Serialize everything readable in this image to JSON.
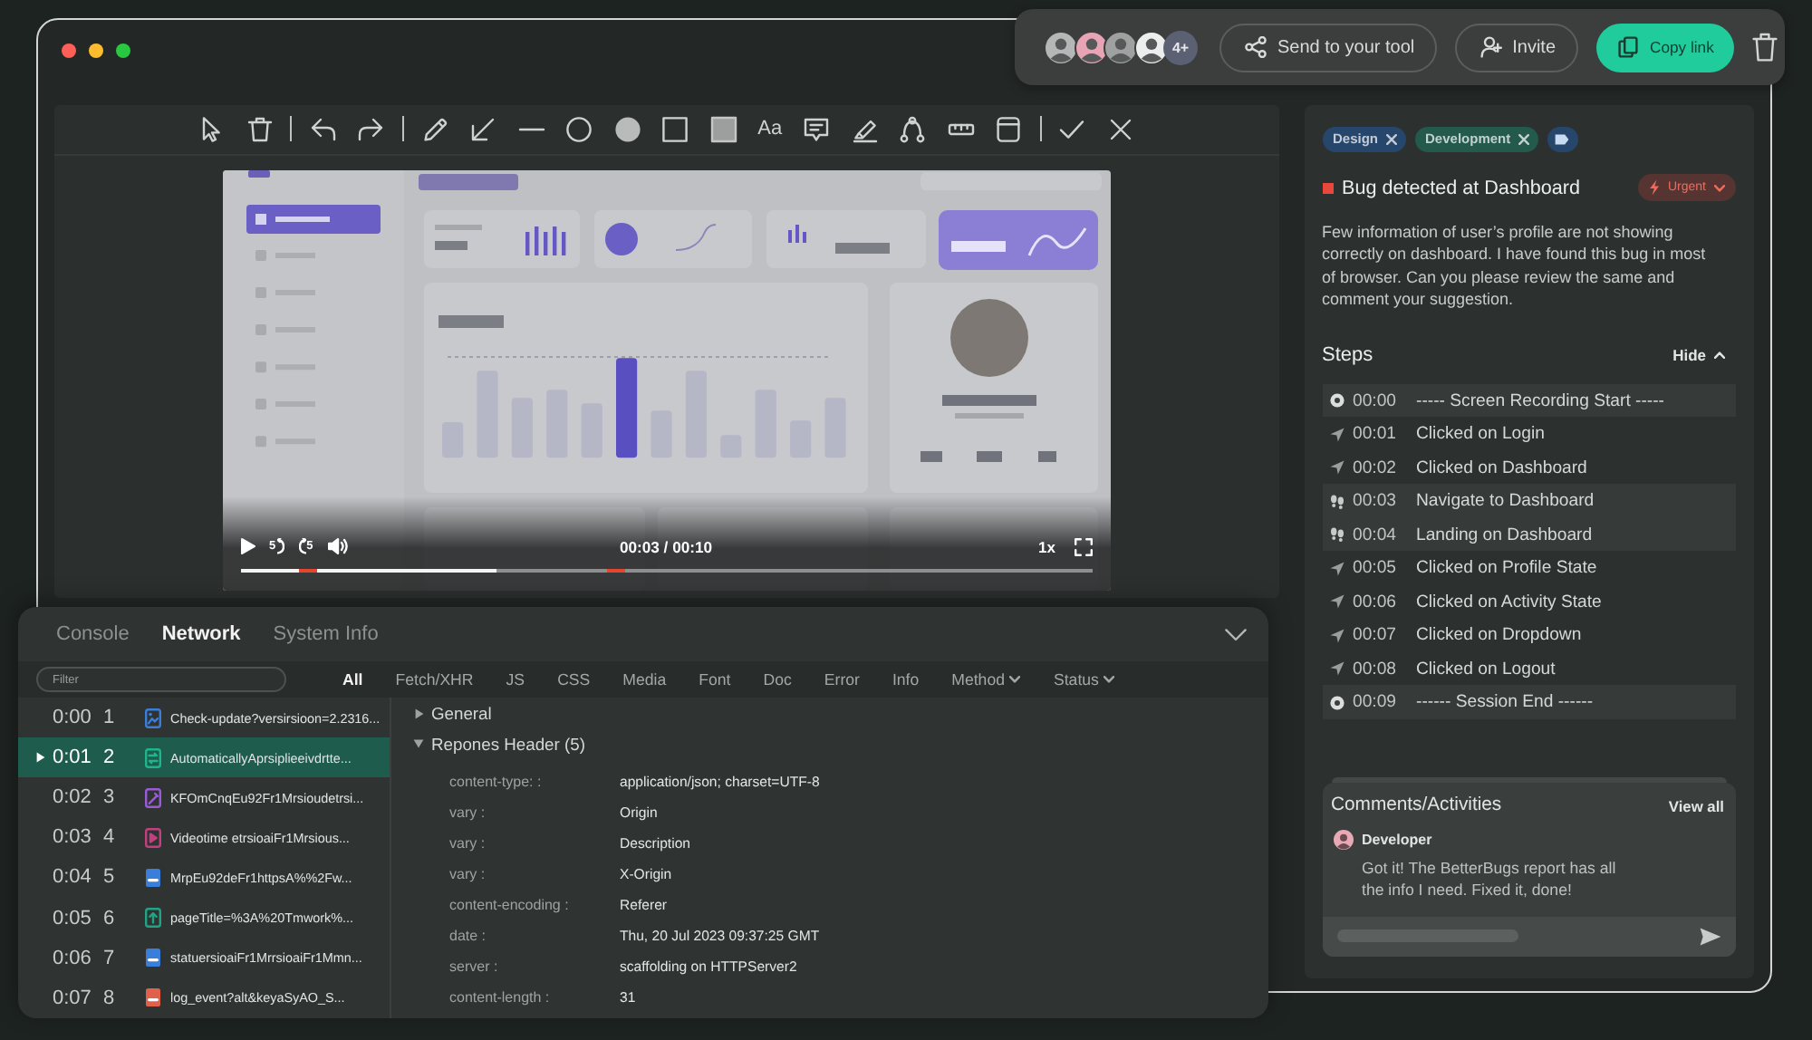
{
  "share_bar": {
    "avatars": [
      {
        "color": "#b4b7b6"
      },
      {
        "color": "#e6a4b4"
      },
      {
        "color": "#9ea1a0"
      },
      {
        "color": "#eceeed"
      }
    ],
    "more_count": "4+",
    "buttons": [
      {
        "kind": "share",
        "label": "Send to your tool"
      },
      {
        "kind": "invite",
        "label": "Invite"
      },
      {
        "kind": "copy",
        "label": "Copy link"
      }
    ]
  },
  "annotation_toolbar": {
    "tools": [
      {
        "kind": "pointer"
      },
      {
        "kind": "trash"
      },
      {
        "kind": "separator"
      },
      {
        "kind": "undo"
      },
      {
        "kind": "redo"
      },
      {
        "kind": "separator"
      },
      {
        "kind": "pencil"
      },
      {
        "kind": "arrow"
      },
      {
        "kind": "line"
      },
      {
        "kind": "circle"
      },
      {
        "kind": "filled_circle"
      },
      {
        "kind": "square"
      },
      {
        "kind": "filled_square"
      },
      {
        "kind": "text",
        "label": "Aa"
      },
      {
        "kind": "comment"
      },
      {
        "kind": "highlighter"
      },
      {
        "kind": "path"
      },
      {
        "kind": "ruler"
      },
      {
        "kind": "window"
      },
      {
        "kind": "separator"
      },
      {
        "kind": "confirm"
      },
      {
        "kind": "cancel"
      }
    ]
  },
  "video": {
    "skip_back": "5",
    "skip_forward": "5",
    "time": "00:03 / 00:10",
    "speed": "1x",
    "progress": {
      "level": 0.3,
      "markers": [
        {
          "level": 0.07
        },
        {
          "level": 0.43
        }
      ]
    }
  },
  "issue": {
    "tags": [
      {
        "label": "Design",
        "color": "#27466c"
      },
      {
        "label": "Development",
        "color": "#235a4b"
      }
    ],
    "title": "Bug detected at Dashboard",
    "priority": "Urgent",
    "description": "Few information of user’s profile are not showing correctly on dashboard. I have found this bug in most of browser. Can you please review the same and comment your suggestion.",
    "steps_title": "Steps",
    "steps_toggle": "Hide",
    "steps": [
      {
        "kind": "record",
        "time": "00:00",
        "text": "----- Screen Recording Start -----"
      },
      {
        "kind": "click",
        "time": "00:01",
        "text": "Clicked on Login"
      },
      {
        "kind": "click",
        "time": "00:02",
        "text": "Clicked on Dashboard"
      },
      {
        "kind": "navigate",
        "time": "00:03",
        "text": "Navigate to Dashboard"
      },
      {
        "kind": "navigate",
        "time": "00:04",
        "text": "Landing on Dashboard"
      },
      {
        "kind": "click",
        "time": "00:05",
        "text": "Clicked on Profile State"
      },
      {
        "kind": "click",
        "time": "00:06",
        "text": "Clicked on Activity State"
      },
      {
        "kind": "click",
        "time": "00:07",
        "text": "Clicked on Dropdown"
      },
      {
        "kind": "click",
        "time": "00:08",
        "text": "Clicked on Logout"
      },
      {
        "kind": "record",
        "time": "00:09",
        "text": "------ Session End ------"
      }
    ],
    "comments": {
      "title": "Comments/Activities",
      "view_all": "View all",
      "items": [
        {
          "author": "Developer",
          "text": "Got it! The BetterBugs report has all the info I need. Fixed it, done!"
        }
      ]
    }
  },
  "devtools": {
    "tabs": [
      {
        "label": "Console",
        "selected": false
      },
      {
        "label": "Network",
        "selected": true
      },
      {
        "label": "System Info",
        "selected": false
      }
    ],
    "filter": {
      "placeholder": "Filter"
    },
    "filter_types": [
      {
        "kind": "option",
        "label": "All",
        "selected": true
      },
      {
        "kind": "option",
        "label": "Fetch/XHR",
        "selected": false
      },
      {
        "kind": "option",
        "label": "JS",
        "selected": false
      },
      {
        "kind": "option",
        "label": "CSS",
        "selected": false
      },
      {
        "kind": "option",
        "label": "Media",
        "selected": false
      },
      {
        "kind": "option",
        "label": "Font",
        "selected": false
      },
      {
        "kind": "option",
        "label": "Doc",
        "selected": false
      },
      {
        "kind": "option",
        "label": "Error",
        "selected": false
      },
      {
        "kind": "option",
        "label": "Info",
        "selected": false
      },
      {
        "kind": "dropdown",
        "label": "Method",
        "selected": false
      },
      {
        "kind": "dropdown",
        "label": "Status",
        "selected": false
      }
    ],
    "requests": [
      {
        "time": "0:00",
        "index": "1",
        "kind": "image",
        "color": "#3b7ddb",
        "name": "Check-update?versirsioon=2.2316...",
        "selected": false
      },
      {
        "time": "0:01",
        "index": "2",
        "kind": "sync",
        "color": "#1fb58c",
        "name": "AutomaticallyAprsiplieeivdrtte...",
        "selected": true
      },
      {
        "time": "0:02",
        "index": "3",
        "kind": "edit",
        "color": "#9b5bd9",
        "name": "KFOmCnqEu92Fr1Mrsioudetrsi...",
        "selected": false
      },
      {
        "time": "0:03",
        "index": "4",
        "kind": "video",
        "color": "#c2407f",
        "name": "Videotime etrsioaiFr1Mrsious...",
        "selected": false
      },
      {
        "time": "0:04",
        "index": "5",
        "kind": "bar",
        "color": "#3b7ddb",
        "name": "MrpEu92deFr1httpsA%%2Fw...",
        "selected": false
      },
      {
        "time": "0:05",
        "index": "6",
        "kind": "upload",
        "color": "#1fa585",
        "name": "pageTitle=%3A%20Tmwork%...",
        "selected": false
      },
      {
        "time": "0:06",
        "index": "7",
        "kind": "bar",
        "color": "#3b7ddb",
        "name": "statuersioaiFr1MrrsioaiFr1Mmn...",
        "selected": false
      },
      {
        "time": "0:07",
        "index": "8",
        "kind": "bar",
        "color": "#e0604b",
        "name": "log_event?alt&keyaSyAO_S...",
        "selected": false
      }
    ],
    "sections": [
      {
        "title": "General",
        "expanded": false
      },
      {
        "title": "Repones Header (5)",
        "expanded": true,
        "headers": [
          {
            "key": "content-type: :",
            "value": "application/json; charset=UTF-8"
          },
          {
            "key": "vary :",
            "value": "Origin"
          },
          {
            "key": "vary :",
            "value": "Description"
          },
          {
            "key": "vary :",
            "value": "X-Origin"
          },
          {
            "key": "content-encoding :",
            "value": "Referer"
          },
          {
            "key": "date :",
            "value": "Thu, 20 Jul 2023 09:37:25 GMT"
          },
          {
            "key": "server :",
            "value": "scaffolding on HTTPServer2"
          },
          {
            "key": "content-length :",
            "value": "31"
          }
        ]
      }
    ]
  }
}
